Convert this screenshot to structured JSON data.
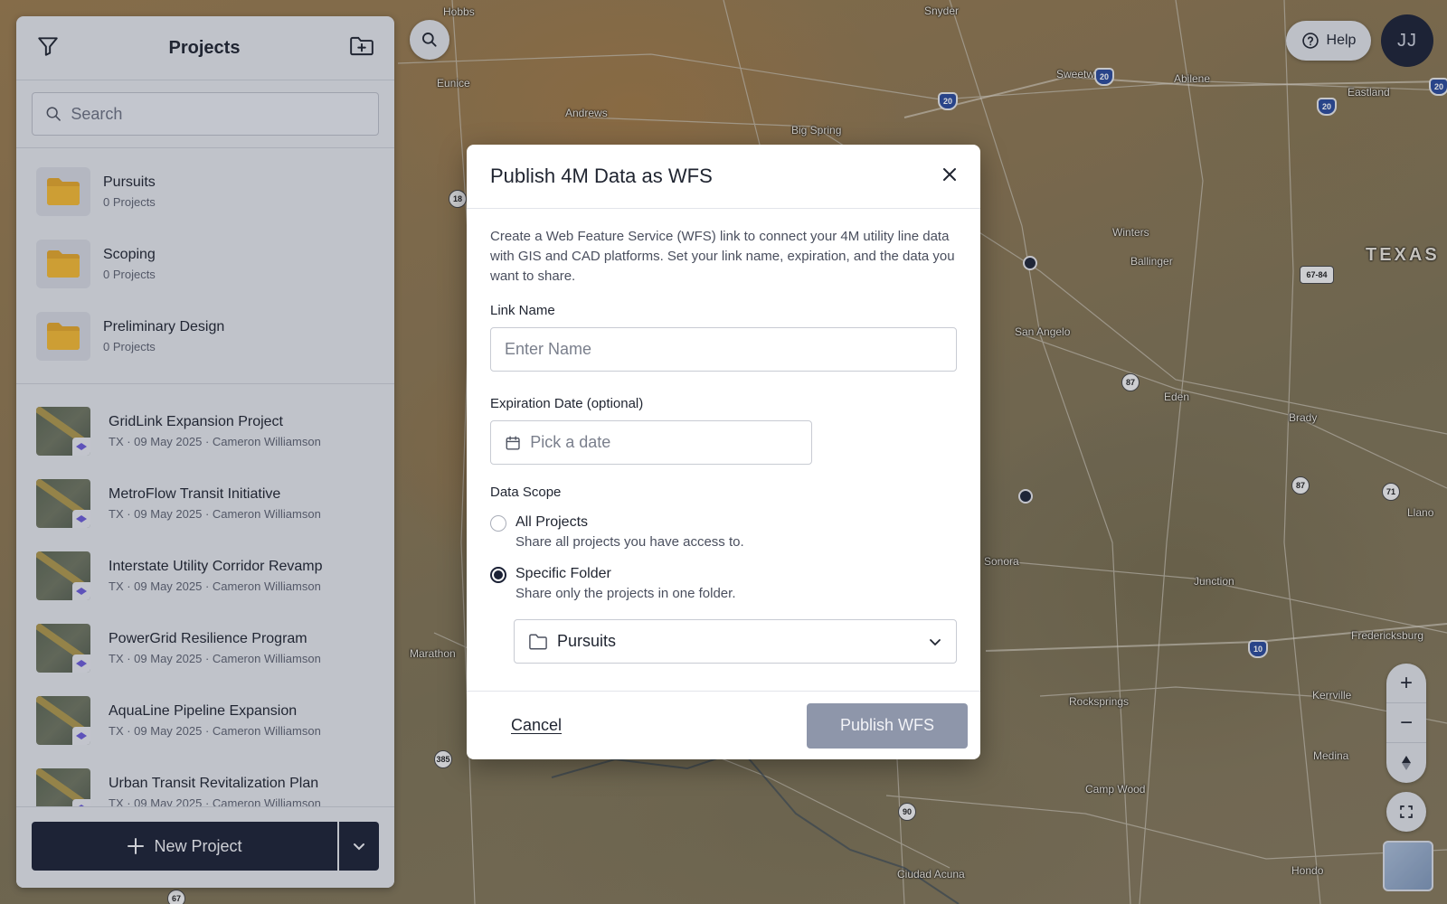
{
  "map": {
    "state_label": "TEXAS",
    "cities": [
      "Hobbs",
      "Snyder",
      "Sweetwater",
      "Abilene",
      "Eastland",
      "Eunice",
      "Andrews",
      "Big Spring",
      "Winters",
      "Ballinger",
      "San Angelo",
      "Eden",
      "Brady",
      "Sonora",
      "Junction",
      "Fredericksburg",
      "Kerrville",
      "Rocksprings",
      "Medina",
      "Camp Wood",
      "Hondo",
      "Ciudad Acuna",
      "Marathon",
      "Llano"
    ],
    "shields": [
      "20",
      "20",
      "20",
      "20",
      "20",
      "18",
      "87",
      "87",
      "71",
      "10",
      "385",
      "90",
      "90",
      "67-84",
      "67"
    ]
  },
  "controls": {
    "help_label": "Help",
    "avatar_initials": "JJ",
    "zoom_in": "+",
    "zoom_out": "−"
  },
  "sidebar": {
    "title": "Projects",
    "search_placeholder": "Search",
    "folders": [
      {
        "name": "Pursuits",
        "count": "0 Projects"
      },
      {
        "name": "Scoping",
        "count": "0 Projects"
      },
      {
        "name": "Preliminary Design",
        "count": "0 Projects"
      }
    ],
    "projects": [
      {
        "name": "GridLink Expansion Project",
        "meta": "TX · 09 May 2025 · Cameron Williamson"
      },
      {
        "name": "MetroFlow Transit Initiative",
        "meta": "TX · 09 May 2025 · Cameron Williamson"
      },
      {
        "name": "Interstate Utility Corridor Revamp",
        "meta": "TX · 09 May 2025 · Cameron Williamson"
      },
      {
        "name": "PowerGrid Resilience Program",
        "meta": "TX · 09 May 2025 · Cameron Williamson"
      },
      {
        "name": "AquaLine Pipeline Expansion",
        "meta": "TX · 09 May 2025 · Cameron Williamson"
      },
      {
        "name": "Urban Transit Revitalization Plan",
        "meta": "TX · 09 May 2025 · Cameron Williamson"
      }
    ],
    "new_project_label": "New Project"
  },
  "modal": {
    "title": "Publish 4M Data as WFS",
    "description": "Create a Web Feature Service (WFS) link to connect your 4M utility line data with GIS and CAD platforms. Set your link name, expiration, and the data you want to share.",
    "link_name_label": "Link Name",
    "link_name_placeholder": "Enter Name",
    "link_name_value": "",
    "expiration_label": "Expiration Date (optional)",
    "expiration_placeholder": "Pick a date",
    "data_scope_label": "Data Scope",
    "scope_options": [
      {
        "title": "All Projects",
        "desc": "Share all projects you have access to.",
        "checked": false
      },
      {
        "title": "Specific Folder",
        "desc": "Share only the projects in one folder.",
        "checked": true
      }
    ],
    "folder_select_value": "Pursuits",
    "cancel_label": "Cancel",
    "publish_label": "Publish WFS"
  }
}
